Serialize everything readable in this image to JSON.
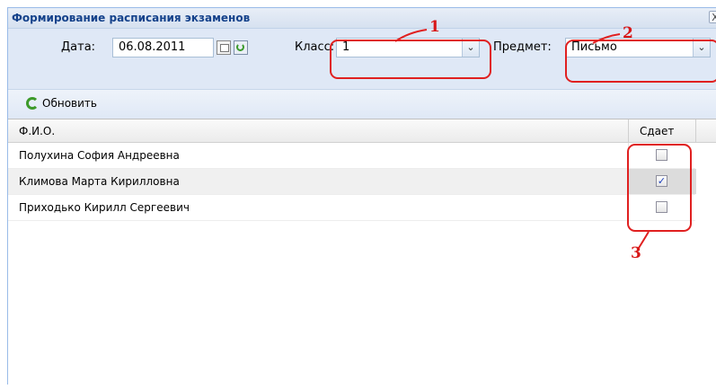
{
  "window": {
    "title": "Формирование расписания экзаменов",
    "close_label": "X"
  },
  "filters": {
    "date_label": "Дата:",
    "date_value": "06.08.2011",
    "class_label": "Класс:",
    "class_value": "1",
    "subject_label": "Предмет:",
    "subject_value": "Письмо"
  },
  "toolbar": {
    "refresh_label": "Обновить"
  },
  "grid": {
    "columns": [
      "Ф.И.О.",
      "Сдает"
    ],
    "rows": [
      {
        "name": "Полухина София Андреевна",
        "passes": false
      },
      {
        "name": "Климова Марта Кирилловна",
        "passes": true
      },
      {
        "name": "Приходько Кирилл Сергеевич",
        "passes": false
      }
    ]
  },
  "annotations": {
    "labels": [
      "1",
      "2",
      "3"
    ],
    "color": "#e02020"
  },
  "icons": [
    "calendar-icon",
    "refresh-date-icon",
    "chevron-down-icon",
    "refresh-icon",
    "close-icon"
  ],
  "colors": {
    "title_text": "#15428b",
    "panel_bg": "#dfe8f6",
    "selected_row": "#f0f0f0"
  }
}
